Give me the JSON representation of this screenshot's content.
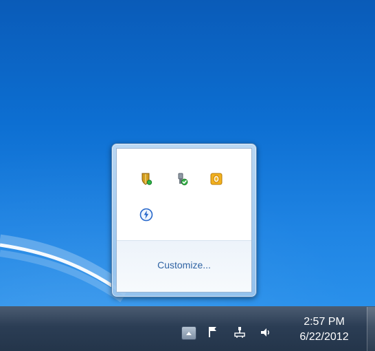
{
  "tray_popup": {
    "icons": [
      {
        "id": "shield-status",
        "icon": "shield-with-green-dot-icon"
      },
      {
        "id": "usb-safe",
        "icon": "usb-check-icon"
      },
      {
        "id": "outlook",
        "icon": "outlook-icon"
      },
      {
        "id": "blue-lightning",
        "icon": "lightning-circle-icon"
      }
    ],
    "customize_label": "Customize..."
  },
  "taskbar": {
    "tray_icons": [
      {
        "id": "show-hidden",
        "icon": "up-arrow-icon"
      },
      {
        "id": "action-center",
        "icon": "flag-icon"
      },
      {
        "id": "network",
        "icon": "network-icon"
      },
      {
        "id": "volume",
        "icon": "speaker-icon"
      }
    ],
    "clock": {
      "time": "2:57 PM",
      "date": "6/22/2012"
    }
  },
  "colors": {
    "desktop_blue": "#0d6fd2",
    "taskbar": "#2a3b52",
    "link_blue": "#2f63a3"
  }
}
